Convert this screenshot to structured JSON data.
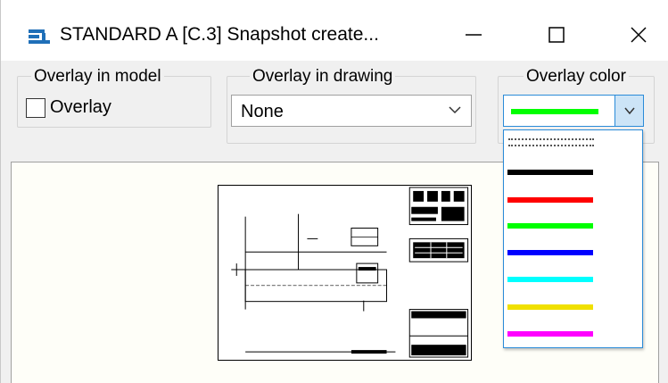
{
  "window": {
    "title": "STANDARD A  [C.3]  Snapshot create...",
    "app_icon": "app-icon",
    "buttons": {
      "minimize_label": "—",
      "maximize_label": "☐",
      "close_label": "✕"
    }
  },
  "overlay_model": {
    "legend": "Overlay in model",
    "checkbox_label": "Overlay",
    "checked": false
  },
  "overlay_drawing": {
    "legend": "Overlay in drawing",
    "value": "None"
  },
  "overlay_color": {
    "legend": "Overlay color",
    "selected_color": "#00ff00",
    "options": [
      {
        "name": "dotted",
        "color": "#555555"
      },
      {
        "name": "black",
        "color": "#000000"
      },
      {
        "name": "red",
        "color": "#ff0000"
      },
      {
        "name": "green",
        "color": "#00ff00"
      },
      {
        "name": "blue",
        "color": "#0000ff"
      },
      {
        "name": "cyan",
        "color": "#00ffff"
      },
      {
        "name": "yellow",
        "color": "#f0e000"
      },
      {
        "name": "magenta",
        "color": "#ff00ff"
      }
    ]
  },
  "colors": {
    "accent": "#2a8bd8",
    "button_hover": "#cce4f7",
    "preview_bg": "#fefef8"
  }
}
